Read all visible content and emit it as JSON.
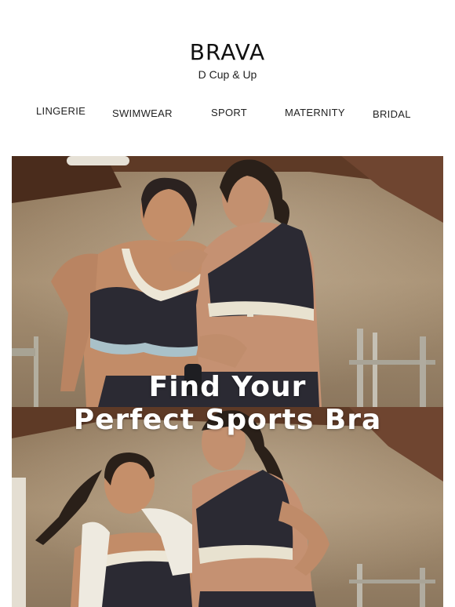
{
  "brand": {
    "logo": "BRAVA",
    "tagline": "D Cup & Up"
  },
  "nav": {
    "items": [
      {
        "label": "LINGERIE"
      },
      {
        "label": "SWIMWEAR"
      },
      {
        "label": "SPORT"
      },
      {
        "label": "MATERNITY"
      },
      {
        "label": "BRIDAL"
      }
    ]
  },
  "hero": {
    "headline_line1": "Find Your",
    "headline_line2": "Perfect Sports Bra"
  },
  "colors": {
    "text": "#111111",
    "photo_wall": "#a38c6e",
    "photo_beam": "#6a3f27",
    "bra_dark": "#2b2a33",
    "bra_cream": "#e8e2d0",
    "skin": "#c4906c"
  }
}
